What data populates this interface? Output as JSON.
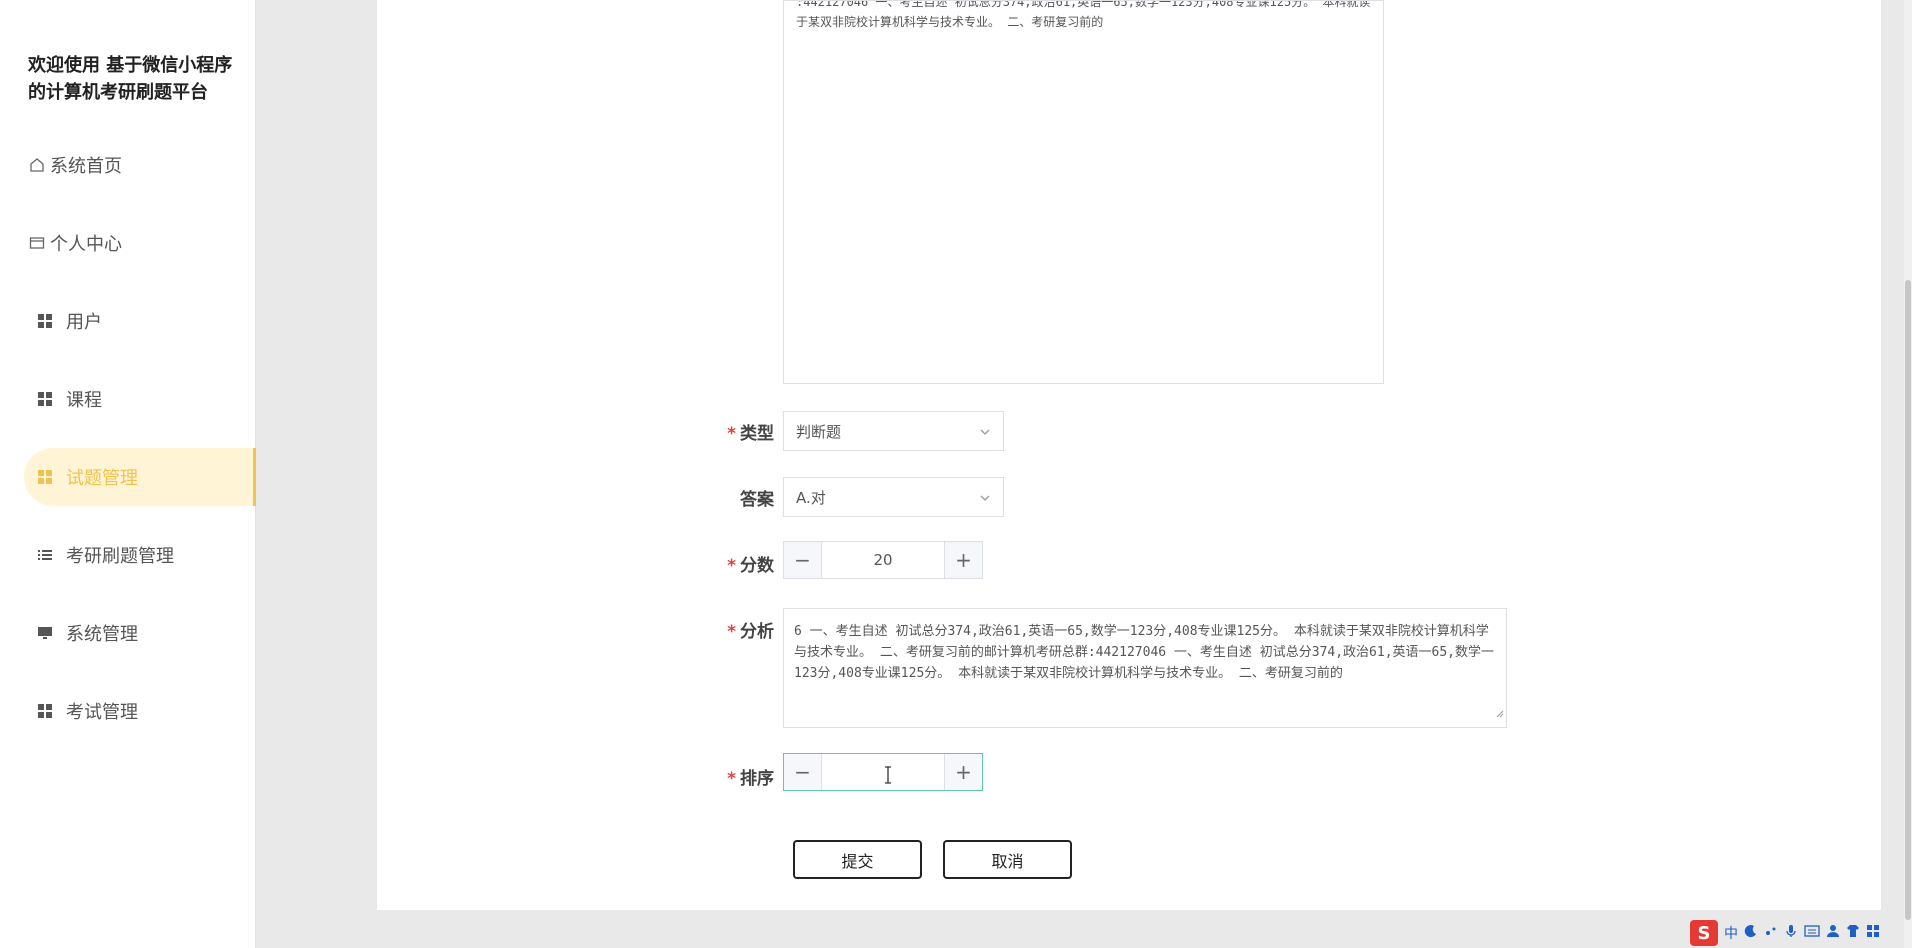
{
  "sidebar": {
    "brand": "欢迎使用 基于微信小程序的计算机考研刷题平台",
    "items": [
      {
        "label": "系统首页",
        "icon": "home-icon"
      },
      {
        "label": "个人中心",
        "icon": "id-card-icon"
      },
      {
        "label": "用户",
        "icon": "grid-icon"
      },
      {
        "label": "课程",
        "icon": "grid-icon"
      },
      {
        "label": "试题管理",
        "icon": "grid-icon",
        "active": true
      },
      {
        "label": "考研刷题管理",
        "icon": "list-icon"
      },
      {
        "label": "系统管理",
        "icon": "monitor-icon"
      },
      {
        "label": "考试管理",
        "icon": "grid-icon"
      }
    ]
  },
  "form": {
    "question_text": ":442127046 一、考生自述 初试总分374,政治61,英语一65,数学一123分,408专业课125分。 本科就读于某双非院校计算机科学与技术专业。 二、考研复习前的",
    "type": {
      "label": "类型",
      "value": "判断题"
    },
    "answer": {
      "label": "答案",
      "value": "A.对"
    },
    "score": {
      "label": "分数",
      "value": "20"
    },
    "analysis": {
      "label": "分析",
      "value": "6 一、考生自述 初试总分374,政治61,英语一65,数学一123分,408专业课125分。 本科就读于某双非院校计算机科学与技术专业。 二、考研复习前的邮计算机考研总群:442127046 一、考生自述 初试总分374,政治61,英语一65,数学一123分,408专业课125分。 本科就读于某双非院校计算机科学与技术专业。 二、考研复习前的"
    },
    "sort": {
      "label": "排序",
      "value": ""
    },
    "submit_label": "提交",
    "cancel_label": "取消"
  },
  "tray": {
    "ime_logo": "S",
    "ime_lang": "中"
  },
  "colors": {
    "accent": "#f2c24e",
    "active_bg": "#fff5d6",
    "required": "#e04040",
    "focus": "#5fc9a8"
  }
}
